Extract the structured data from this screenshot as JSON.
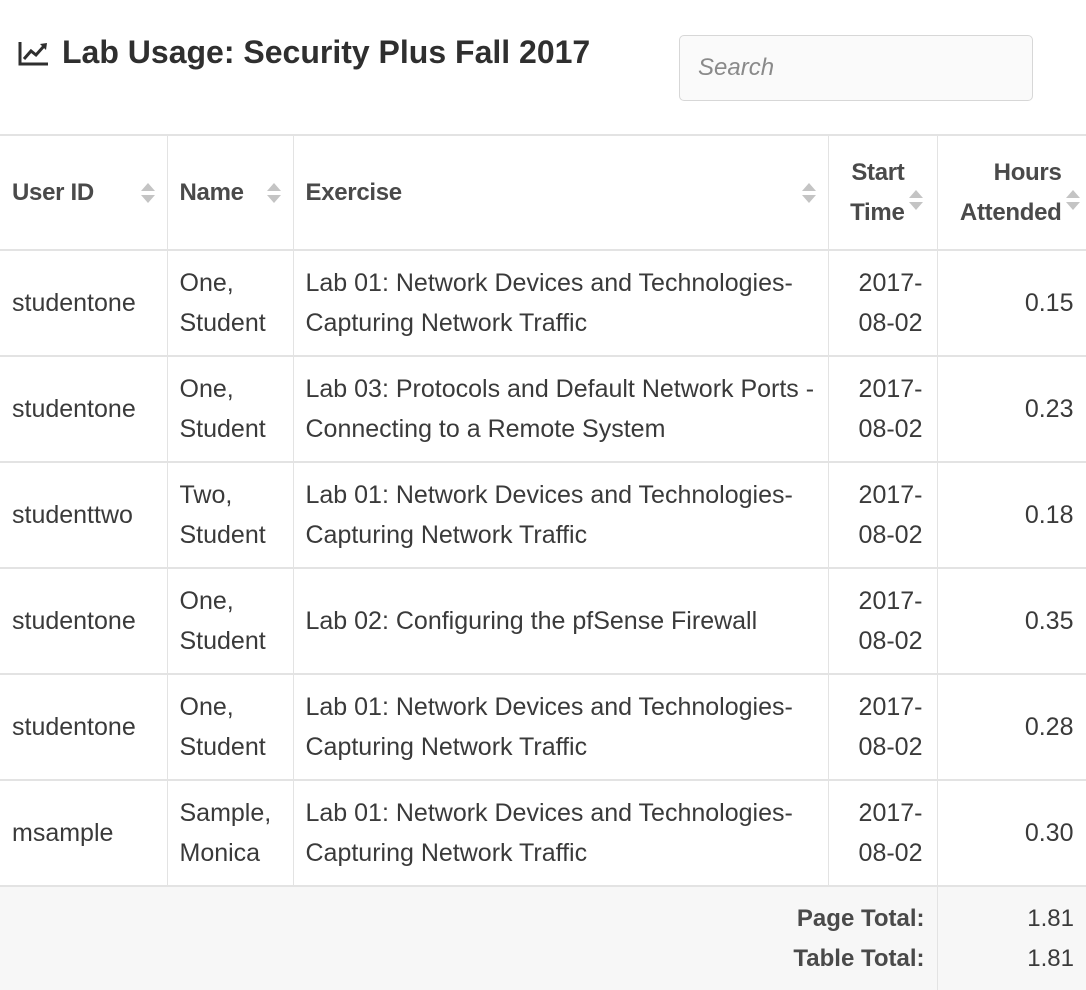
{
  "header": {
    "title": "Lab Usage: Security Plus Fall 2017",
    "title_icon": "line-chart-icon",
    "search_placeholder": "Search"
  },
  "table": {
    "columns": [
      "User ID",
      "Name",
      "Exercise",
      "Start Time",
      "Hours Attended"
    ],
    "rows": [
      {
        "user_id": "studentone",
        "name": "One, Student",
        "exercise": "Lab 01: Network Devices and Technologies- Capturing Network Traffic",
        "start": "2017-08-02",
        "hours": "0.15"
      },
      {
        "user_id": "studentone",
        "name": "One, Student",
        "exercise": "Lab 03: Protocols and Default Network Ports - Connecting to a Remote System",
        "start": "2017-08-02",
        "hours": "0.23"
      },
      {
        "user_id": "studenttwo",
        "name": "Two, Student",
        "exercise": "Lab 01: Network Devices and Technologies- Capturing Network Traffic",
        "start": "2017-08-02",
        "hours": "0.18"
      },
      {
        "user_id": "studentone",
        "name": "One, Student",
        "exercise": "Lab 02: Configuring the pfSense Firewall",
        "start": "2017-08-02",
        "hours": "0.35"
      },
      {
        "user_id": "studentone",
        "name": "One, Student",
        "exercise": "Lab 01: Network Devices and Technologies- Capturing Network Traffic",
        "start": "2017-08-02",
        "hours": "0.28"
      },
      {
        "user_id": "msample",
        "name": "Sample, Monica",
        "exercise": "Lab 01: Network Devices and Technologies- Capturing Network Traffic",
        "start": "2017-08-02",
        "hours": "0.30"
      }
    ],
    "footer": {
      "page_total_label": "Page Total:",
      "page_total": "1.81",
      "table_total_label": "Table Total:",
      "table_total": "1.81"
    }
  }
}
